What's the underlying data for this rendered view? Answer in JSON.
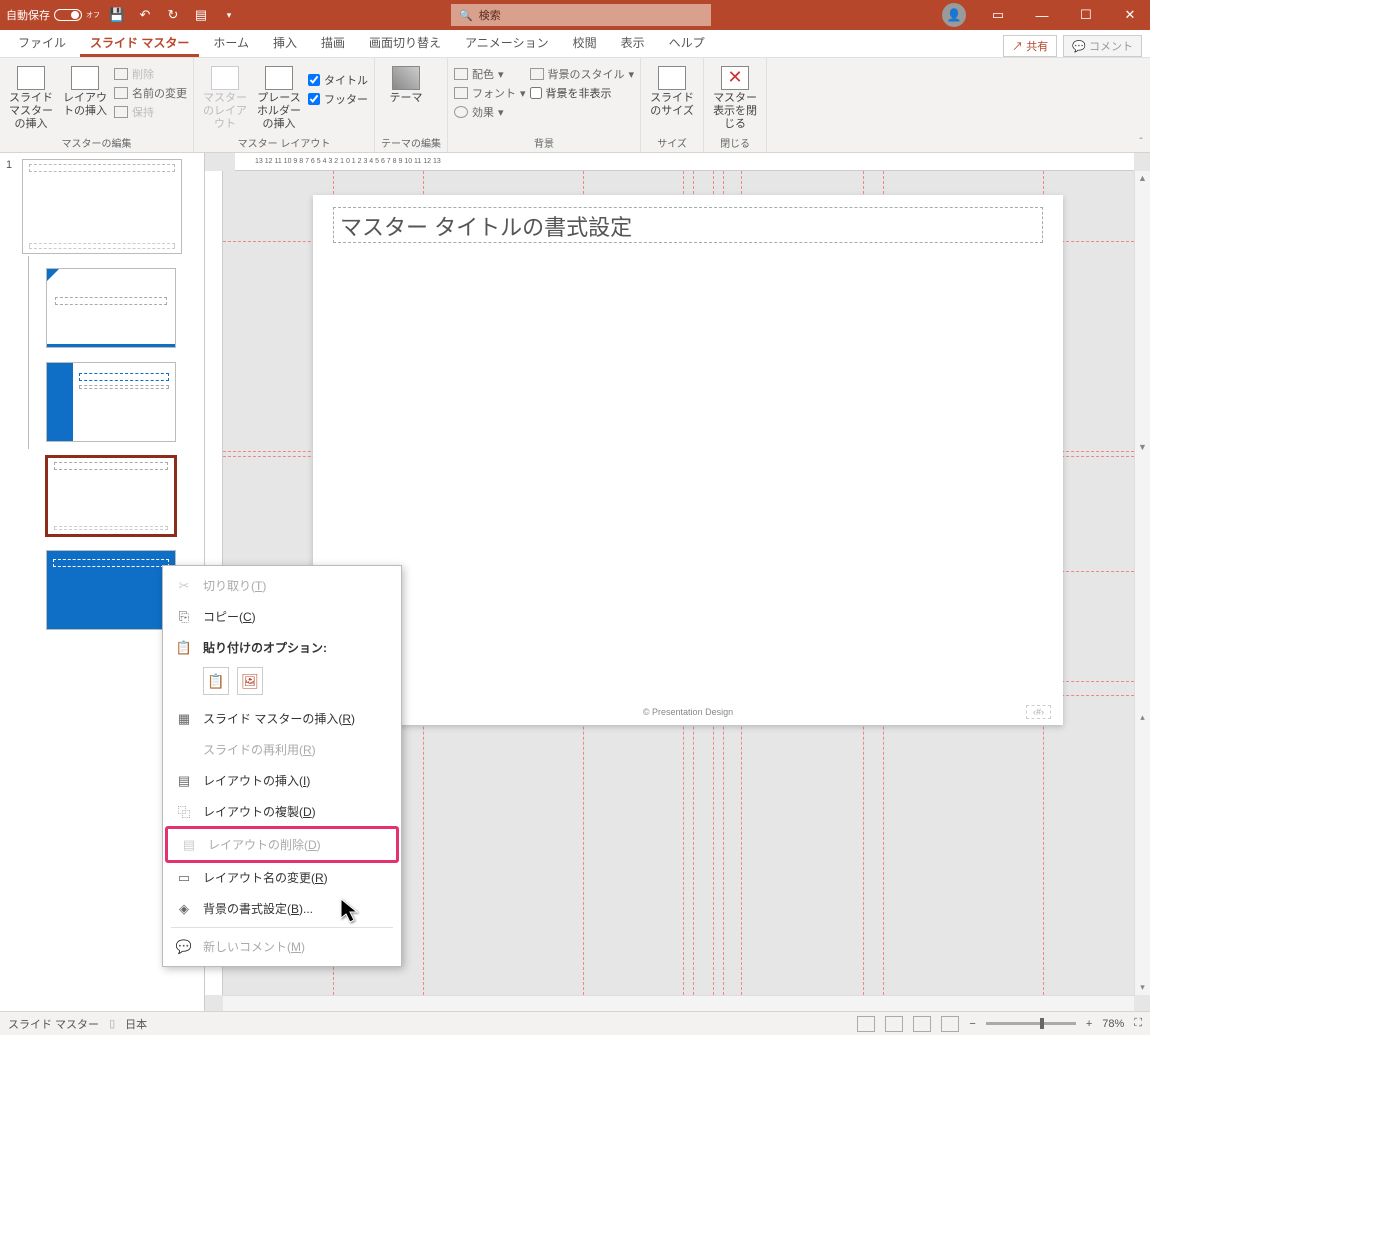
{
  "titlebar": {
    "autosave_label": "自動保存",
    "autosave_state": "オフ",
    "search_placeholder": "検索"
  },
  "tabs": {
    "items": [
      "ファイル",
      "スライド マスター",
      "ホーム",
      "挿入",
      "描画",
      "画面切り替え",
      "アニメーション",
      "校閲",
      "表示",
      "ヘルプ"
    ],
    "active_index": 1,
    "share": "共有",
    "comment": "コメント"
  },
  "ribbon": {
    "g1": {
      "insert_master": "スライド マスターの挿入",
      "insert_layout": "レイアウトの挿入",
      "delete": "削除",
      "rename": "名前の変更",
      "preserve": "保持",
      "label": "マスターの編集"
    },
    "g2": {
      "master_layout": "マスターのレイアウト",
      "insert_ph": "プレースホルダーの挿入",
      "chk_title": "タイトル",
      "chk_footer": "フッター",
      "label": "マスター レイアウト"
    },
    "g3": {
      "themes": "テーマ",
      "label": "テーマの編集"
    },
    "g4": {
      "colors": "配色",
      "fonts": "フォント",
      "effects": "効果",
      "bg_styles": "背景のスタイル",
      "hide_bg": "背景を非表示",
      "label": "背景"
    },
    "g5": {
      "slide_size": "スライドのサイズ",
      "label": "サイズ"
    },
    "g6": {
      "close": "マスター表示を閉じる",
      "label": "閉じる"
    }
  },
  "thumbnails": {
    "master_num": "1"
  },
  "slide": {
    "title_placeholder": "マスター タイトルの書式設定",
    "footer_text": "© Presentation Design",
    "page_num_placeholder": "‹#›"
  },
  "ruler_text": "13  12  11  10  9  8  7  6  5  4  3  2  1  0  1  2  3  4  5  6  7  8  9  10  11  12  13",
  "context_menu": {
    "cut": "切り取り(",
    "cut_k": "T",
    "copy": "コピー(",
    "copy_k": "C",
    "paste_label": "貼り付けのオプション:",
    "insert_master": "スライド マスターの挿入(",
    "insert_master_k": "R",
    "reuse_slides": "スライドの再利用(",
    "reuse_slides_k": "R",
    "insert_layout": "レイアウトの挿入(",
    "insert_layout_k": "I",
    "dup_layout": "レイアウトの複製(",
    "dup_layout_k": "D",
    "del_layout": "レイアウトの削除(",
    "del_layout_k": "D",
    "rename_layout": "レイアウト名の変更(",
    "rename_layout_k": "R",
    "bg_format": "背景の書式設定(",
    "bg_format_k": "B",
    "bg_format_suffix": ")...",
    "new_comment": "新しいコメント(",
    "new_comment_k": "M",
    "close_paren": ")"
  },
  "statusbar": {
    "mode": "スライド マスター",
    "lang": "日本",
    "zoom": "78%"
  }
}
